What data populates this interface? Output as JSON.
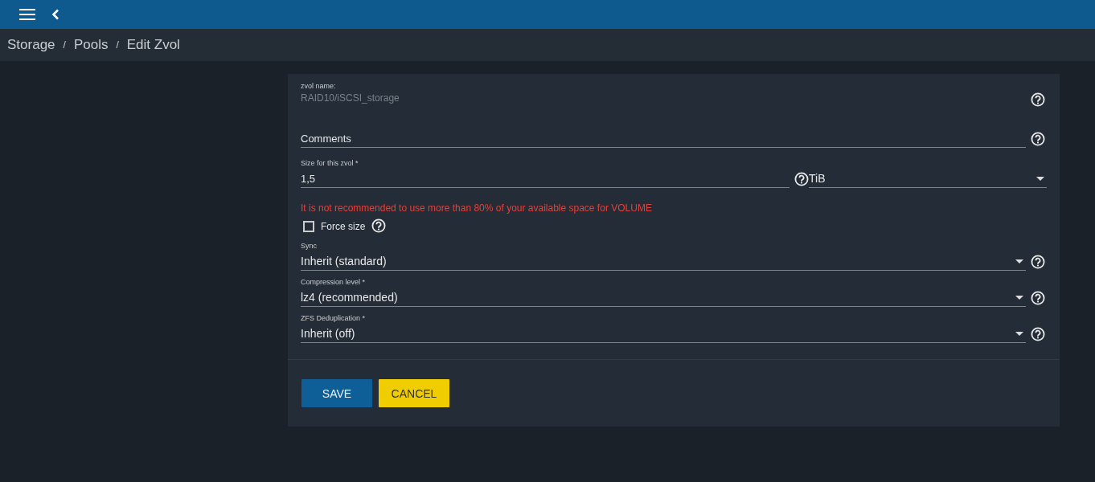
{
  "breadcrumb": [
    {
      "label": "Storage",
      "separator": "/"
    },
    {
      "label": "Pools",
      "separator": "/"
    },
    {
      "label": "Edit Zvol"
    }
  ],
  "fields": [
    {
      "kind": "readonly",
      "label": "zvol name:",
      "value": "RAID10/iSCSI_storage"
    },
    {
      "kind": "text",
      "placeholder": "Comments"
    },
    {
      "kind": "size",
      "label": "Size for this zvol *",
      "value": "1,5",
      "unit": "TiB"
    },
    {
      "kind": "warning",
      "text": "It is not recommended to use more than 80% of your available space for VOLUME"
    },
    {
      "kind": "checkbox",
      "label": "Force size",
      "checked": false
    },
    {
      "kind": "select",
      "label": "Sync",
      "value": "Inherit (standard)"
    },
    {
      "kind": "select",
      "label": "Compression level *",
      "value": "lz4 (recommended)"
    },
    {
      "kind": "select",
      "label": "ZFS Deduplication *",
      "value": "Inherit (off)"
    }
  ],
  "buttons": [
    {
      "label": "SAVE",
      "kind": "primary"
    },
    {
      "label": "CANCEL",
      "kind": "secondary"
    }
  ]
}
